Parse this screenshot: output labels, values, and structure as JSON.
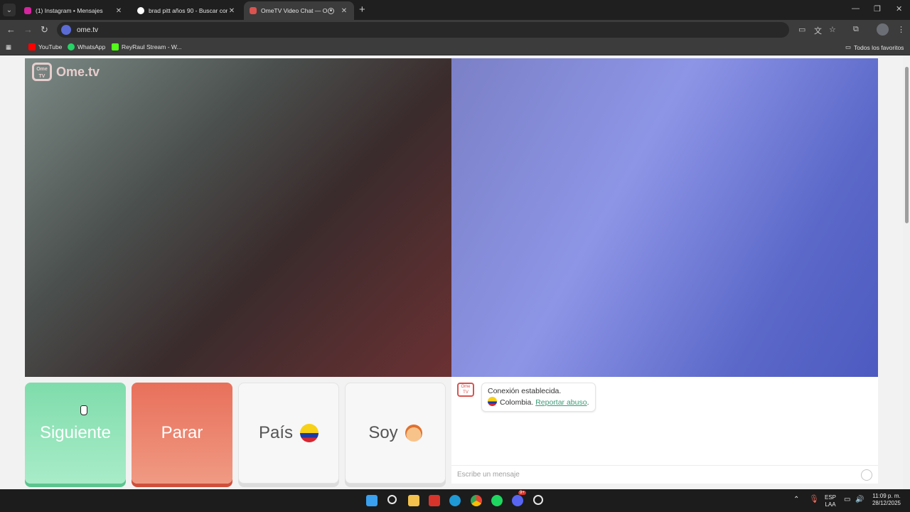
{
  "browser": {
    "tabs": [
      {
        "title": "(1) Instagram • Mensajes",
        "active": false,
        "favicon_color": "#d6249f"
      },
      {
        "title": "brad pitt años 90 - Buscar con G",
        "active": false,
        "favicon_color": "#ffffff"
      },
      {
        "title": "OmeTV Video Chat — Ome",
        "active": true,
        "favicon_color": "#d9534f"
      }
    ],
    "url": "ome.tv",
    "bookmarks": [
      {
        "label": "YouTube",
        "color": "#ff0000"
      },
      {
        "label": "WhatsApp",
        "color": "#25d366"
      },
      {
        "label": "ReyRaul Stream - W...",
        "color": "#53fc18"
      }
    ],
    "all_bookmarks_label": "Todos los favoritos"
  },
  "video": {
    "logo_text": "Ome.tv",
    "logo_badge": "Ome TV"
  },
  "controls": {
    "next_label": "Siguiente",
    "stop_label": "Parar",
    "country_label": "País",
    "gender_label": "Soy"
  },
  "chat": {
    "logo_badge": "Ome TV",
    "connection_message": "Conexión establecida.",
    "country_name": "Colombia.",
    "report_link": "Reportar abuso",
    "report_suffix": ".",
    "input_placeholder": "Escribe un mensaje"
  },
  "taskbar": {
    "language_top": "ESP",
    "language_bottom": "LAA",
    "time": "11:09 p. m.",
    "date": "28/12/2025",
    "discord_badge": "9+"
  }
}
